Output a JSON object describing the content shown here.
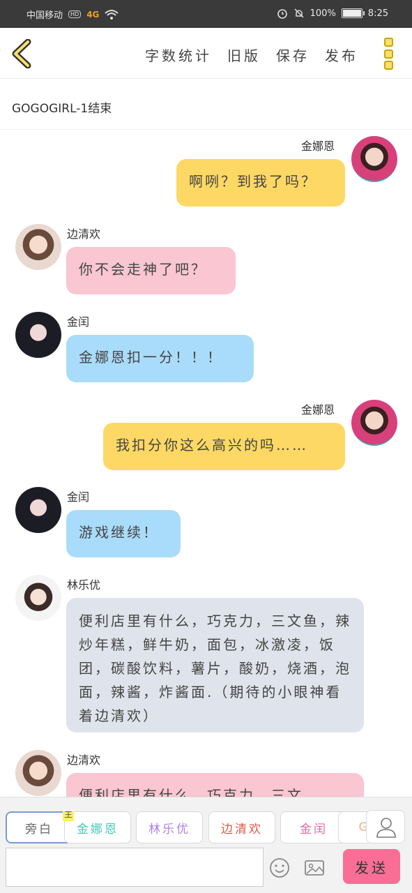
{
  "status": {
    "carrier": "中国移动",
    "hd": "HD",
    "network": "4G",
    "battery": "100%",
    "time": "8:25"
  },
  "header": {
    "actions": [
      "字数统计",
      "旧版",
      "保存",
      "发布"
    ]
  },
  "chapter_title": "GOGOGIRL-1结束",
  "messages": [
    {
      "name": "金娜恩",
      "side": "right",
      "color": "#fdd864",
      "text": "啊咧？到我了吗？",
      "avatar": "pink-purple"
    },
    {
      "name": "边清欢",
      "side": "left",
      "color": "#f9c6d2",
      "text": "你不会走神了吧？",
      "avatar": "light"
    },
    {
      "name": "金闰",
      "side": "left",
      "color": "#a9dcfa",
      "text": "金娜恩扣一分！！！",
      "avatar": "dark"
    },
    {
      "name": "金娜恩",
      "side": "right",
      "color": "#fdd864",
      "text": "我扣分你这么高兴的吗……",
      "avatar": "pink-purple"
    },
    {
      "name": "金闰",
      "side": "left",
      "color": "#a9dcfa",
      "text": "游戏继续！",
      "avatar": "dark"
    },
    {
      "name": "林乐优",
      "side": "left",
      "color": "#dfe4ec",
      "text": "便利店里有什么，巧克力，三文鱼，辣炒年糕，鲜牛奶，面包，冰激凌，饭团，碳酸饮料，薯片，酸奶，烧酒，泡面，辣酱，炸酱面.（期待的小眼神看着边清欢）",
      "avatar": "white"
    },
    {
      "name": "边清欢",
      "side": "left",
      "color": "#f9c6d2",
      "text": "便利店里有什么，巧克力，三文",
      "avatar": "light"
    }
  ],
  "roles": [
    {
      "label": "旁白",
      "color": "#666666",
      "active": true
    },
    {
      "label": "金娜恩",
      "color": "#48c8b8",
      "active": false
    },
    {
      "label": "林乐优",
      "color": "#b080e0",
      "active": false
    },
    {
      "label": "边清欢",
      "color": "#e05a4a",
      "active": false
    },
    {
      "label": "金闰",
      "color": "#e06aa0",
      "active": false
    },
    {
      "label": "GIF",
      "color": "#f0b080",
      "active": false
    }
  ],
  "main_tag": "主",
  "send_label": "发送",
  "input_value": ""
}
